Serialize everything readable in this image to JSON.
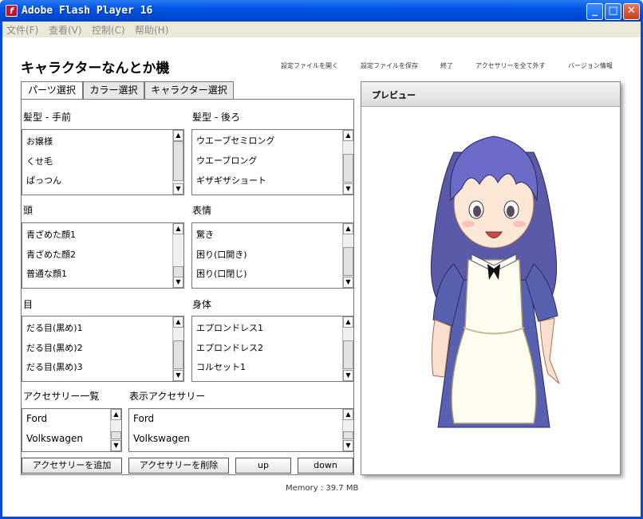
{
  "window": {
    "title": "Adobe Flash Player 16",
    "minimize": "_",
    "maximize": "□",
    "close": "✕"
  },
  "menu": [
    {
      "label": "文件(F)"
    },
    {
      "label": "查看(V)"
    },
    {
      "label": "控制(C)"
    },
    {
      "label": "帮助(H)"
    }
  ],
  "app_title": "キャラクターなんとか機",
  "top_links": [
    {
      "label": "設定ファイルを開く"
    },
    {
      "label": "設定ファイルを保存"
    },
    {
      "label": "終了"
    },
    {
      "label": "アクセサリーを全て外す"
    },
    {
      "label": "バージョン情報"
    }
  ],
  "tabs": [
    {
      "label": "パーツ選択"
    },
    {
      "label": "カラー選択"
    },
    {
      "label": "キャラクター選択"
    }
  ],
  "sections": [
    {
      "label": "髪型 - 手前",
      "items": [
        "お嬢様",
        "くせ毛",
        "ぱっつん"
      ],
      "thumb_pos": 0.0
    },
    {
      "label": "髪型 - 後ろ",
      "items": [
        "ウエーブセミロング",
        "ウエーブロング",
        "ギザギザショート"
      ],
      "thumb_pos": 0.55
    },
    {
      "label": "頭",
      "items": [
        "青ざめた顔1",
        "青ざめた顔2",
        "普通な顔1"
      ],
      "thumb_pos": 0.3
    },
    {
      "label": "表情",
      "items": [
        "驚き",
        "困り(口開き)",
        "困り(口閉じ)"
      ],
      "thumb_pos": 0.55
    },
    {
      "label": "目",
      "items": [
        "だる目(黒め)1",
        "だる目(黒め)2",
        "だる目(黒め)3"
      ],
      "thumb_pos": 0.3
    },
    {
      "label": "身体",
      "items": [
        "エプロンドレス1",
        "エプロンドレス2",
        "コルセット1"
      ],
      "thumb_pos": 0.55
    }
  ],
  "accessory_list": {
    "label": "アクセサリー一覧",
    "items": [
      "Ford",
      "Volkswagen"
    ]
  },
  "shown_accessories": {
    "label": "表示アクセサリー",
    "items": [
      "Ford",
      "Volkswagen"
    ]
  },
  "buttons": {
    "add": "アクセサリーを追加",
    "remove": "アクセサリーを削除",
    "up": "up",
    "down": "down"
  },
  "memory": "Memory : 39.7 MB",
  "preview": {
    "title": "プレビュー"
  },
  "colors": {
    "titlebar": "#0055e5",
    "hair": "#6b6bc8",
    "dress": "#5860b0",
    "apron": "#fffdf0"
  }
}
